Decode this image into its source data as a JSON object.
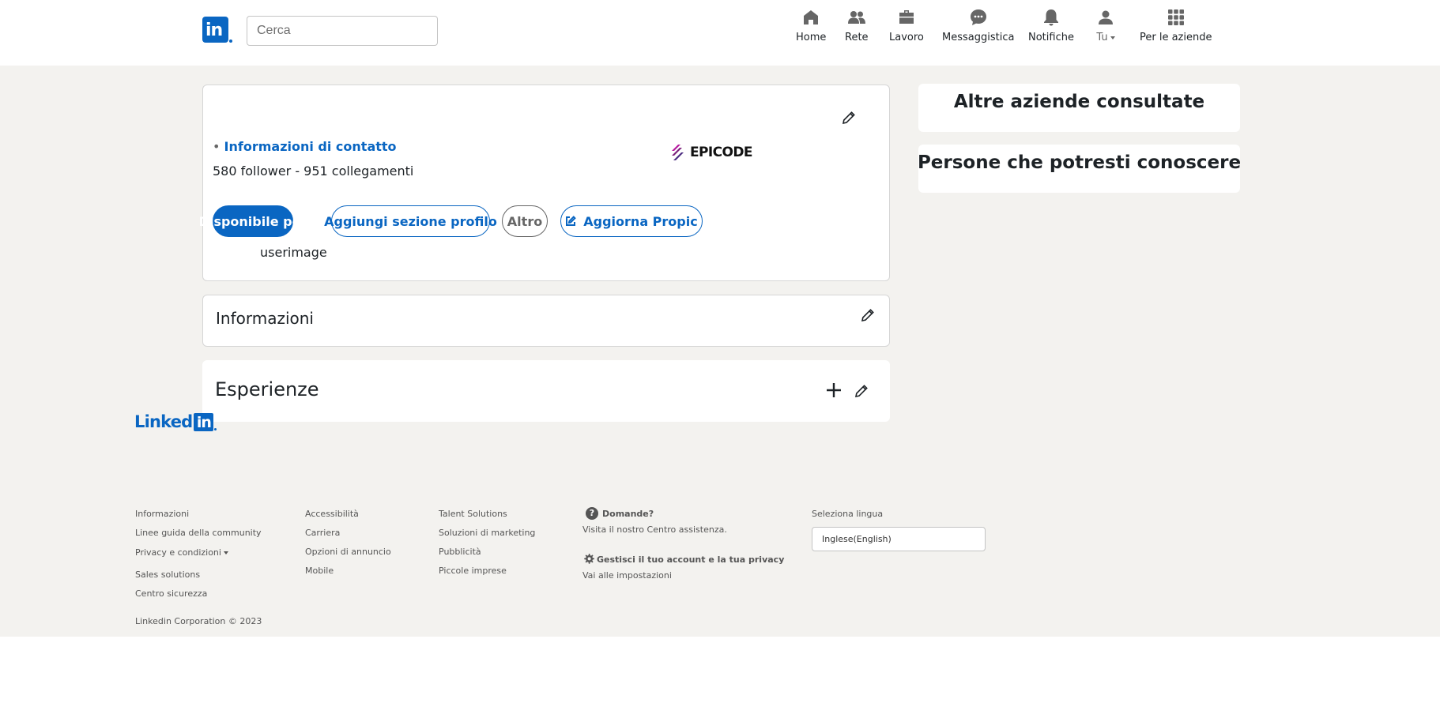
{
  "header": {
    "logo_text": "in",
    "search_placeholder": "Cerca",
    "nav": [
      {
        "label": "Home",
        "icon": "home-icon"
      },
      {
        "label": "Rete",
        "icon": "people-icon"
      },
      {
        "label": "Lavoro",
        "icon": "briefcase-icon"
      },
      {
        "label": "Messaggistica",
        "icon": "chat-icon"
      },
      {
        "label": "Notifiche",
        "icon": "bell-icon"
      },
      {
        "label": "Tu",
        "icon": "user-icon"
      },
      {
        "label": "Per le aziende",
        "icon": "grid-icon"
      }
    ]
  },
  "profile": {
    "bullet": "•",
    "contact_info": "Informazioni di contatto",
    "stats": "580 follower - 951 collegamenti",
    "company_logo_text": "EPICODE",
    "buttons": {
      "available": "Disponibile per",
      "add_section": "Aggiungi sezione profilo",
      "more": "Altro",
      "update_pic": "Aggiorna Propic"
    },
    "image_alt": "userimage"
  },
  "sections": {
    "info_title": "Informazioni",
    "experience_title": "Esperienze"
  },
  "sidebar": {
    "other_companies": "Altre aziende consultate",
    "people_you_may_know": "Persone che potresti conoscere"
  },
  "footer": {
    "logo_text": "Linked",
    "logo_box": "in",
    "col1": [
      "Informazioni",
      "Linee guida della community",
      "Privacy e condizioni",
      "Sales solutions",
      "Centro sicurezza"
    ],
    "col2": [
      "Accessibilità",
      "Carriera",
      "Opzioni di annuncio",
      "Mobile"
    ],
    "col3": [
      "Talent Solutions",
      "Soluzioni di marketing",
      "Pubblicità",
      "Piccole imprese"
    ],
    "help_title": "Domande?",
    "help_link": "Visita il nostro Centro assistenza.",
    "account_title": "Gestisci il tuo account e la tua privacy",
    "account_link": "Vai alle impostazioni",
    "language_label": "Seleziona lingua",
    "language_value": "Inglese(English)",
    "copyright": "Linkedin Corporation © 2023"
  },
  "colors": {
    "brand": "#0a66c2",
    "background": "#f3f2ef"
  }
}
